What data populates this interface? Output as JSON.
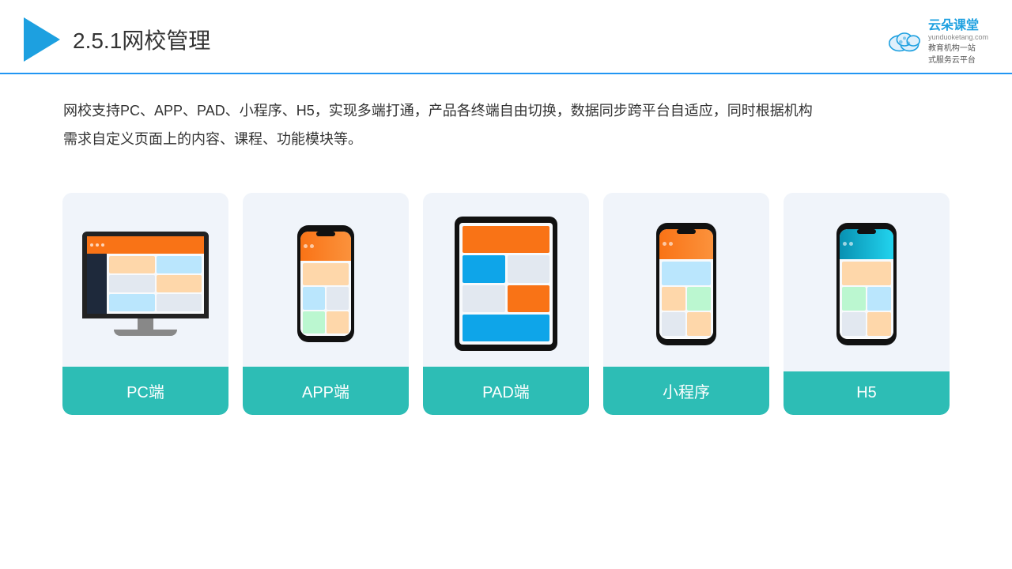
{
  "header": {
    "title": "2.5.1网校管理",
    "brand": {
      "name": "云朵课堂",
      "url": "yunduoketang.com",
      "slogan": "教育机构一站\n式服务云平台"
    }
  },
  "description": "网校支持PC、APP、PAD、小程序、H5，实现多端打通，产品各终端自由切换，数据同步跨平台自适应，同时根据机构\n需求自定义页面上的内容、课程、功能模块等。",
  "cards": [
    {
      "id": "pc",
      "label": "PC端"
    },
    {
      "id": "app",
      "label": "APP端"
    },
    {
      "id": "pad",
      "label": "PAD端"
    },
    {
      "id": "miniprogram",
      "label": "小程序"
    },
    {
      "id": "h5",
      "label": "H5"
    }
  ],
  "accent_color": "#2dbdb5",
  "title_color": "#333333"
}
